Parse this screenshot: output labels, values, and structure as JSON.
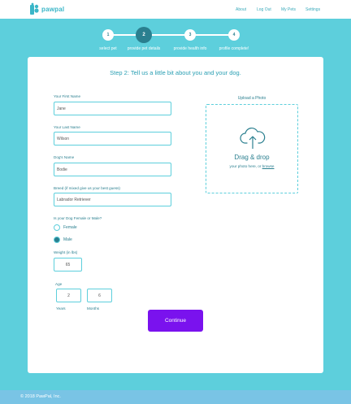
{
  "header": {
    "logo_text": "pawpal",
    "nav": [
      "About",
      "Log Out",
      "My Pets",
      "Settings"
    ]
  },
  "stepper": {
    "steps": [
      {
        "number": "1",
        "label": "select pet"
      },
      {
        "number": "2",
        "label": "provide pet details"
      },
      {
        "number": "3",
        "label": "provide health info"
      },
      {
        "number": "4",
        "label": "profile complete!"
      }
    ],
    "active_step": 2
  },
  "form": {
    "title": "Step 2: Tell us a little bit about you and your dog.",
    "first_name": {
      "label": "Your First Name",
      "value": "Jane"
    },
    "last_name": {
      "label": "Your Last Name",
      "value": "Wilson"
    },
    "dog_name": {
      "label": "Dog's Name",
      "value": "Bodie"
    },
    "breed": {
      "label": "Breed (if mixed give us your best guess)",
      "value": "Labrador Retriever"
    },
    "sex": {
      "label": "Is your Dog Female or Male?",
      "options": [
        "Female",
        "Male"
      ],
      "selected": "Male"
    },
    "weight": {
      "label": "Weight (in lbs)",
      "value": "65"
    },
    "age": {
      "label": "Age",
      "years_value": "2",
      "years_label": "Years",
      "months_value": "6",
      "months_label": "Months"
    },
    "continue_label": "Continue"
  },
  "upload": {
    "title": "Upload a Photo",
    "main": "Drag & drop",
    "sub_prefix": "your photo here, or",
    "browse_link": "browse"
  },
  "footer": {
    "text": "© 2018 PawPal, Inc."
  },
  "colors": {
    "background": "#5dcfdc",
    "primary": "#2a7f8f",
    "accent_button": "#7a12ee",
    "footer": "#79c4e5"
  }
}
